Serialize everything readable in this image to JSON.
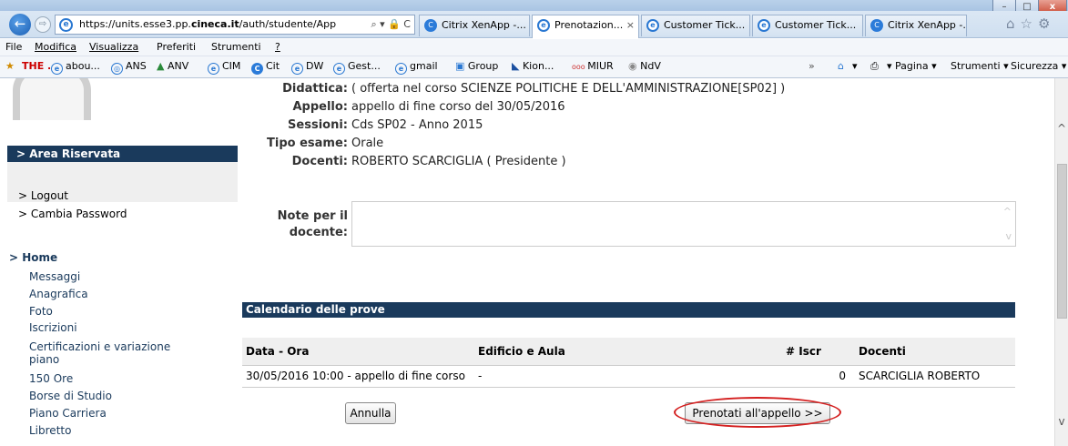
{
  "browser": {
    "address": {
      "url_prefix": "https://units.esse3.pp.",
      "url_domain": "cineca.it",
      "url_suffix": "/auth/studente/App",
      "controls": "⌕ ▾ 🔒 C"
    },
    "tabs": [
      {
        "label": "Citrix XenApp -...",
        "icon": "C",
        "close": ""
      },
      {
        "label": "Prenotazion...",
        "icon": "e",
        "close": "×"
      },
      {
        "label": "Customer Tick...",
        "icon": "e",
        "close": ""
      },
      {
        "label": "Customer Tick...",
        "icon": "e",
        "close": ""
      },
      {
        "label": "Citrix XenApp -...",
        "icon": "C",
        "close": ""
      }
    ],
    "nav_icons": "⌂☆⚙",
    "back_glyph": "←",
    "forward_glyph": "⇨",
    "window_buttons": {
      "min": "–",
      "max": "□",
      "close": "x"
    }
  },
  "menubar": {
    "items": [
      "File",
      "Modifica",
      "Visualizza",
      "Preferiti",
      "Strumenti",
      "?"
    ]
  },
  "favorites": {
    "items": [
      "THE .",
      "abou...",
      "ANS",
      "ANV",
      "CIM",
      "Cit",
      "DW",
      "Gest...",
      "gmail",
      "Group",
      "Kion...",
      "MIUR",
      "NdV"
    ],
    "overflow": "»",
    "commands": [
      "▾",
      "▾ Pagina ▾",
      "Strumenti ▾",
      "Sicurezza ▾",
      "▾"
    ]
  },
  "sidebar": {
    "area_riservata": "> Area Riservata",
    "logout": "> Logout",
    "cambia_password": "> Cambia Password",
    "home": "> Home",
    "menu": [
      "Messaggi",
      "Anagrafica",
      "Foto",
      "Iscrizioni",
      "Certificazioni e variazione",
      "piano",
      "150 Ore",
      "Borse di Studio",
      "Piano Carriera",
      "Libretto"
    ]
  },
  "details": {
    "didattica_label": "Didattica:",
    "didattica_value": "( offerta nel corso  SCIENZE POLITICHE E DELL'AMMINISTRAZIONE[SP02] )",
    "appello_label": "Appello:",
    "appello_value": "appello di fine corso del 30/05/2016",
    "sessioni_label": "Sessioni:",
    "sessioni_value": "Cds SP02 - Anno 2015",
    "tipo_label": "Tipo esame:",
    "tipo_value": "Orale",
    "docenti_label": "Docenti:",
    "docenti_value": "ROBERTO SCARCIGLIA ( Presidente )",
    "note_label_1": "Note per il",
    "note_label_2": "docente:"
  },
  "calendar": {
    "title": "Calendario delle prove",
    "columns": [
      "Data - Ora",
      "Edificio e Aula",
      "# Iscr",
      "Docenti"
    ],
    "rows": [
      [
        "30/05/2016  10:00 - appello di fine corso",
        "-",
        "0",
        "SCARCIGLIA ROBERTO"
      ]
    ]
  },
  "actions": {
    "annulla": "Annulla",
    "prenotati": "Prenotati all'appello >>"
  }
}
